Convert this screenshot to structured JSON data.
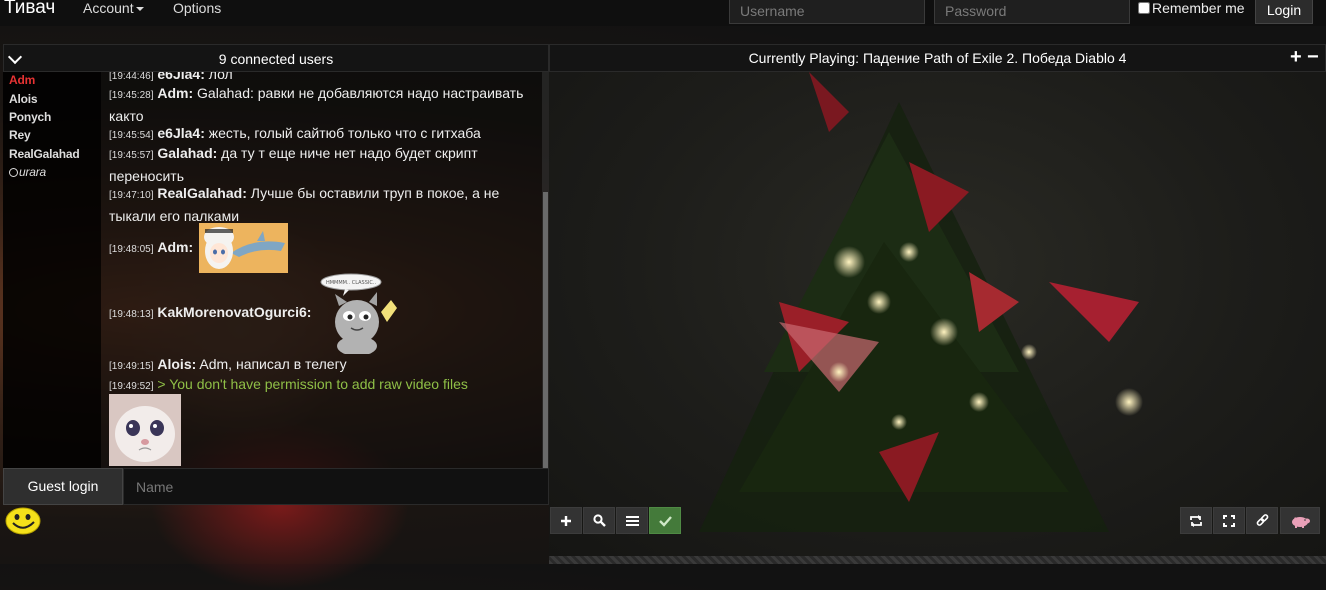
{
  "navbar": {
    "brand": "Тивач",
    "account_label": "Account",
    "options_label": "Options",
    "username_placeholder": "Username",
    "password_placeholder": "Password",
    "remember_label": "Remember me",
    "login_label": "Login"
  },
  "chat": {
    "header": "9 connected users",
    "users": [
      {
        "name": "Adm",
        "role": "admin"
      },
      {
        "name": "Alois",
        "role": "user"
      },
      {
        "name": "Ponych",
        "role": "user"
      },
      {
        "name": "Rey",
        "role": "user"
      },
      {
        "name": "RealGalahad",
        "role": "user"
      },
      {
        "name": "urara",
        "role": "afk"
      }
    ],
    "messages": [
      {
        "time": "[19:44:46]",
        "nick": "e6Jla4:",
        "text": "лол"
      },
      {
        "time": "[19:45:28]",
        "nick": "Adm:",
        "text": "Galahad: равки не добавляются надо настраивать както"
      },
      {
        "time": "[19:45:54]",
        "nick": "e6Jla4:",
        "text": "жесть, голый сайтюб только что с гитхаба"
      },
      {
        "time": "[19:45:57]",
        "nick": "Galahad:",
        "text": "да ту т еще ниче нет надо будет скрипт переносить"
      },
      {
        "time": "[19:47:10]",
        "nick": "RealGalahad:",
        "text": "Лучше бы оставили труп в покое, а не тыкали его палками"
      },
      {
        "time": "[19:48:05]",
        "nick": "Adm:",
        "text": ""
      },
      {
        "time": "[19:48:13]",
        "nick": "KakMorenovatOgurci6:",
        "text": ""
      },
      {
        "time": "[19:49:15]",
        "nick": "Alois:",
        "text": "Adm, написал в телегу"
      },
      {
        "time": "[19:49:52]",
        "nick": "",
        "text": "> You don't have permission to add raw video files"
      }
    ],
    "emote_caption": "HMMMM.. CLASSIC..",
    "guest_login_label": "Guest login",
    "name_placeholder": "Name",
    "colors": {
      "admin": "#e63333",
      "system": "#8fbf47"
    }
  },
  "video": {
    "current_title": "Currently Playing: Падение Path of Exile 2. Победа Diablo 4",
    "add_label": "+",
    "remove_label": "−",
    "controls_left": [
      "add-icon",
      "search-icon",
      "list-icon",
      "check-icon"
    ],
    "controls_right": [
      "repeat-icon",
      "fullscreen-icon",
      "link-icon",
      "pig-icon"
    ]
  }
}
